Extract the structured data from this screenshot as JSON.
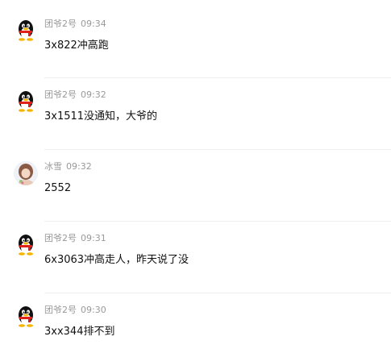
{
  "messages": [
    {
      "user": "团爷2号",
      "time": "09:34",
      "text": "3x822冲高跑",
      "avatar": "qq-penguin-icon"
    },
    {
      "user": "团爷2号",
      "time": "09:32",
      "text": "3x1511没通知，大爷的",
      "avatar": "qq-penguin-icon"
    },
    {
      "user": "冰雪",
      "time": "09:32",
      "text": "2552",
      "avatar": "photo-avatar"
    },
    {
      "user": "团爷2号",
      "time": "09:31",
      "text": "6x3063冲高走人，昨天说了没",
      "avatar": "qq-penguin-icon"
    },
    {
      "user": "团爷2号",
      "time": "09:30",
      "text": "3xx344排不到",
      "avatar": "qq-penguin-icon"
    }
  ],
  "colors": {
    "meta_text": "#999999",
    "body_text": "#111111",
    "divider": "#eeeeee",
    "penguin_scarf": "#e0201b",
    "penguin_beak": "#f5b400"
  }
}
